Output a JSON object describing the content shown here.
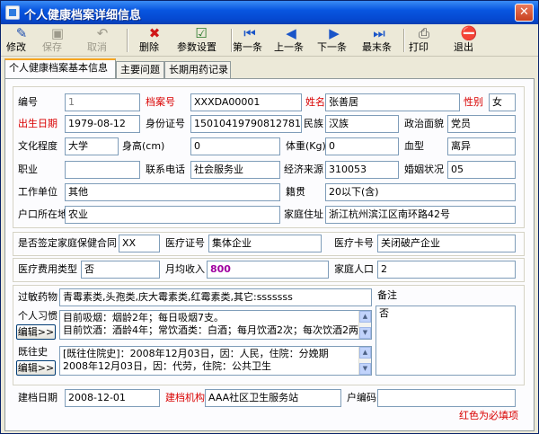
{
  "window": {
    "title": "个人健康档案详细信息",
    "close_symbol": "✕"
  },
  "toolbar": {
    "buttons": [
      {
        "label": "修改",
        "icon": "edit-icon",
        "glyph": "✎",
        "color": "#1e4fb0",
        "enabled": true
      },
      {
        "label": "保存",
        "icon": "save-icon",
        "glyph": "▣",
        "color": "#9d9a8b",
        "enabled": false
      },
      {
        "label": "取消",
        "icon": "undo-icon",
        "glyph": "↶",
        "color": "#9d9a8b",
        "enabled": false
      },
      {
        "label": "删除",
        "icon": "delete-icon",
        "glyph": "✖",
        "color": "#d01818",
        "enabled": true
      },
      {
        "label": "参数设置",
        "icon": "settings-icon",
        "glyph": "☑",
        "color": "#2a7a2a",
        "enabled": true
      },
      {
        "label": "第一条",
        "icon": "first-record-icon",
        "glyph": "⏮",
        "color": "#1a55c8",
        "enabled": true
      },
      {
        "label": "上一条",
        "icon": "previous-record-icon",
        "glyph": "◀",
        "color": "#1a55c8",
        "enabled": true
      },
      {
        "label": "下一条",
        "icon": "next-record-icon",
        "glyph": "▶",
        "color": "#1a55c8",
        "enabled": true
      },
      {
        "label": "最末条",
        "icon": "last-record-icon",
        "glyph": "⏭",
        "color": "#1a55c8",
        "enabled": true
      },
      {
        "label": "打印",
        "icon": "print-icon",
        "glyph": "⎙",
        "color": "#404040",
        "enabled": true
      },
      {
        "label": "退出",
        "icon": "exit-icon",
        "glyph": "⛔",
        "color": "#d01818",
        "enabled": true
      }
    ]
  },
  "tabs": [
    "个人健康档案基本信息",
    "主要问题",
    "长期用药记录"
  ],
  "labels": {
    "id": "编号",
    "archive_no": "档案号",
    "name": "姓名",
    "gender": "性别",
    "birth_date": "出生日期",
    "id_card": "身份证号",
    "ethnicity": "民族",
    "political": "政治面貌",
    "education": "文化程度",
    "height": "身高(cm)",
    "weight": "体重(Kg)",
    "blood_type": "血型",
    "occupation": "职业",
    "phone": "联系电话",
    "income_source": "经济来源",
    "marital": "婚姻状况",
    "workplace": "工作单位",
    "native_place": "籍贯",
    "hukou": "户口所在地",
    "home_address": "家庭住址",
    "family_contract": "是否签定家庭保健合同",
    "medical_cert": "医疗证号",
    "medical_card": "医疗卡号",
    "expense_type": "医疗费用类型",
    "monthly_income": "月均收入",
    "family_size": "家庭人口",
    "allergy": "过敏药物",
    "habits": "个人习惯",
    "history": "既往史",
    "remarks": "备注",
    "created_date": "建档日期",
    "created_org": "建档机构",
    "household_code": "户编码"
  },
  "values": {
    "id": "1",
    "archive_no": "XXXDA00001",
    "name": "张善居",
    "gender": "女",
    "birth_date": "1979-08-12",
    "id_card": "150104197908127810",
    "ethnicity": "汉族",
    "political": "党员",
    "education": "大学",
    "height": "0",
    "weight": "0",
    "blood_type": "离异",
    "occupation": "",
    "phone": "社会服务业",
    "income_source": "310053",
    "marital": "05",
    "workplace": "其他",
    "native_place": "20以下(含)",
    "hukou": "农业",
    "home_address": "浙江杭州滨江区南环路42号",
    "family_contract": "XX",
    "medical_cert": "集体企业",
    "medical_card": "关闭破产企业",
    "expense_type": "否",
    "monthly_income": "800",
    "family_size": "2",
    "allergy": "青霉素类,头孢类,庆大霉素类,红霉素类,其它:sssssss",
    "habits": [
      "目前吸烟：烟龄2年；每日吸烟7支。",
      "目前饮酒：酒龄4年；常饮酒类：白酒；每月饮酒2次；每次饮酒2两"
    ],
    "history": [
      "[既往住院史]：2008年12月03日，因：人民，住院：分娩期",
      "2008年12月03日，因：代劳，住院：公共卫生"
    ],
    "remarks": "否",
    "created_date": "2008-12-01",
    "created_org": "AAA社区卫生服务站",
    "household_code": ""
  },
  "edit_button_label": "编辑>>",
  "scroll_up": "▲",
  "scroll_down": "▼",
  "footer_note": "红色为必填项"
}
